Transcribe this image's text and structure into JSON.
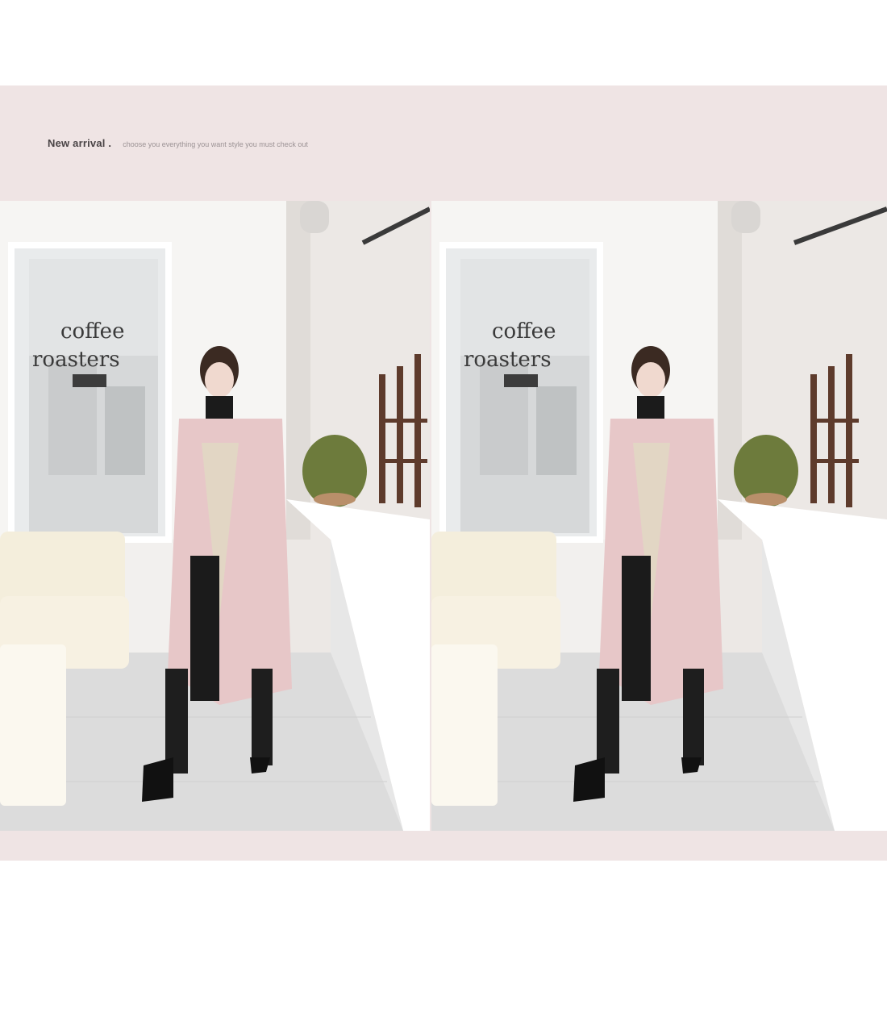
{
  "header": {
    "title": "New arrival .",
    "tagline": "choose you everything you want style you must check out"
  },
  "photos": [
    {
      "id": "left",
      "icon": "model-photo"
    },
    {
      "id": "right",
      "icon": "model-photo"
    }
  ],
  "colors": {
    "banner": "#efe4e4",
    "coat": "#e7c7c8",
    "title": "#4a4446",
    "tagline": "#9c9395"
  }
}
